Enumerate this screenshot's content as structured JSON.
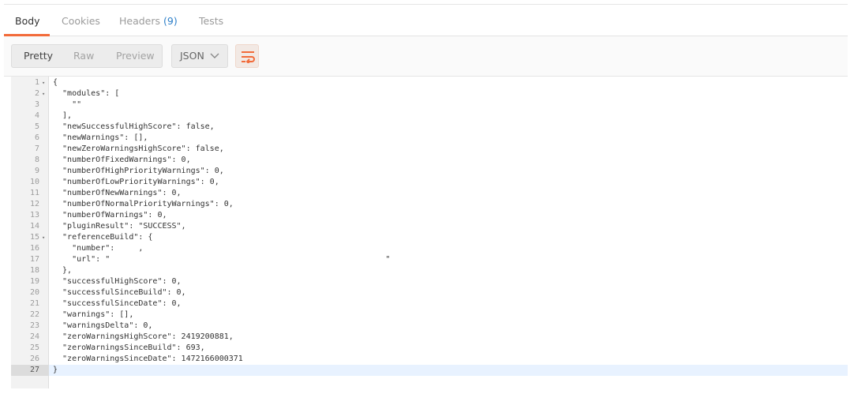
{
  "tabs": [
    {
      "label": "Body",
      "count": ""
    },
    {
      "label": "Cookies",
      "count": ""
    },
    {
      "label": "Headers",
      "count": "(9)"
    },
    {
      "label": "Tests",
      "count": ""
    }
  ],
  "view_modes": [
    "Pretty",
    "Raw",
    "Preview"
  ],
  "format": {
    "selected": "JSON"
  },
  "icons": {
    "format_chevron": "chevron-down-icon",
    "wrap": "wrap-lines-icon",
    "fold": "fold-arrow-icon"
  },
  "colors": {
    "accent": "#f26b3a",
    "headers_count": "#2f80c9"
  },
  "code_lines": [
    "{",
    "  \"modules\": [",
    "    \"\"",
    "  ],",
    "  \"newSuccessfulHighScore\": false,",
    "  \"newWarnings\": [],",
    "  \"newZeroWarningsHighScore\": false,",
    "  \"numberOfFixedWarnings\": 0,",
    "  \"numberOfHighPriorityWarnings\": 0,",
    "  \"numberOfLowPriorityWarnings\": 0,",
    "  \"numberOfNewWarnings\": 0,",
    "  \"numberOfNormalPriorityWarnings\": 0,",
    "  \"numberOfWarnings\": 0,",
    "  \"pluginResult\": \"SUCCESS\",",
    "  \"referenceBuild\": {",
    "    \"number\":     ,",
    "    \"url\": \"                                                          \"",
    "  },",
    "  \"successfulHighScore\": 0,",
    "  \"successfulSinceBuild\": 0,",
    "  \"successfulSinceDate\": 0,",
    "  \"warnings\": [],",
    "  \"warningsDelta\": 0,",
    "  \"zeroWarningsHighScore\": 2419200881,",
    "  \"zeroWarningsSinceBuild\": 693,",
    "  \"zeroWarningsSinceDate\": 1472166000371",
    "}"
  ],
  "line_numbers": [
    "1",
    "2",
    "3",
    "4",
    "5",
    "6",
    "7",
    "8",
    "9",
    "10",
    "11",
    "12",
    "13",
    "14",
    "15",
    "16",
    "17",
    "18",
    "19",
    "20",
    "21",
    "22",
    "23",
    "24",
    "25",
    "26",
    "27"
  ],
  "foldable_lines": [
    1,
    2,
    15
  ]
}
